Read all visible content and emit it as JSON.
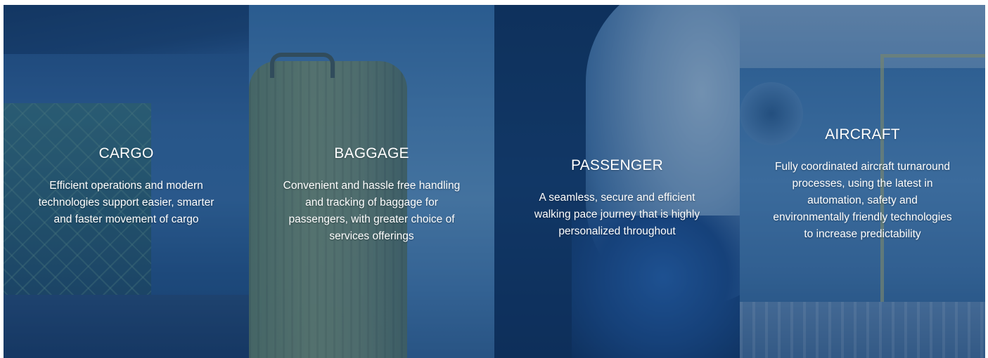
{
  "panels": [
    {
      "id": "cargo",
      "title": "CARGO",
      "description": "Efficient operations and modern technologies support easier, smarter and faster movement of cargo"
    },
    {
      "id": "baggage",
      "title": "BAGGAGE",
      "description": "Convenient and hassle free handling and tracking of baggage for passengers, with greater choice of services offerings"
    },
    {
      "id": "passenger",
      "title": "PASSENGER",
      "description": "A seamless, secure and efficient walking pace journey that is highly personalized throughout"
    },
    {
      "id": "aircraft",
      "title": "AIRCRAFT",
      "description": "Fully coordinated aircraft turnaround processes, using the latest in automation, safety and environmentally friendly technologies to increase predictability"
    }
  ],
  "colors": {
    "overlay": "#0e3466",
    "text": "#ffffff"
  }
}
